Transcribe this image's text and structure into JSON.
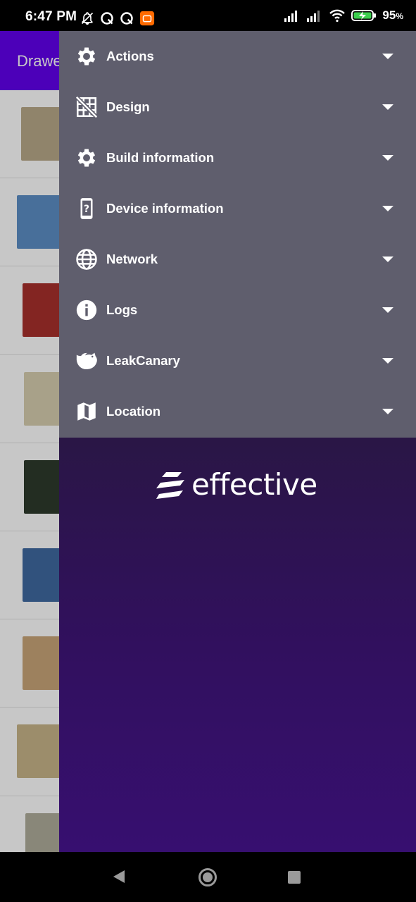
{
  "status_bar": {
    "time": "6:47 PM",
    "battery": "95",
    "battery_unit": "%",
    "icons": [
      "bell-off-icon",
      "q-app-icon",
      "q-app-icon",
      "mi-app-icon",
      "signal-icon",
      "signal-icon",
      "wifi-icon",
      "battery-charging-icon"
    ]
  },
  "app": {
    "title": "Drawer",
    "items": [
      {
        "cover": "zelda-link-to-the-past-cover",
        "color": "#b9a98a"
      },
      {
        "cover": "zelda-phantom-hourglass-cover",
        "color": "#5d8fc6"
      },
      {
        "cover": "zelda-oracle-of-seasons-cover",
        "color": "#a8302c"
      },
      {
        "cover": "zelda-minish-cap-cover",
        "color": "#d8cfb0"
      },
      {
        "cover": "zelda-majoras-mask-cover",
        "color": "#2e3a2c"
      },
      {
        "cover": "zelda-oracle-of-ages-cover",
        "color": "#3f6aa0"
      },
      {
        "cover": "zelda-links-awakening-dx-cover",
        "color": "#c9a679"
      },
      {
        "cover": "zelda-a-link-to-the-past-snes-cover",
        "color": "#c8b58a"
      },
      {
        "cover": "zelda-nes-cover",
        "color": "#b0ad9c"
      }
    ]
  },
  "drawer": {
    "menu": [
      {
        "label": "Actions",
        "icon": "gear-icon"
      },
      {
        "label": "Design",
        "icon": "grid-off-icon"
      },
      {
        "label": "Build information",
        "icon": "gear-icon"
      },
      {
        "label": "Device information",
        "icon": "device-unknown-icon"
      },
      {
        "label": "Network",
        "icon": "globe-icon"
      },
      {
        "label": "Logs",
        "icon": "info-icon"
      },
      {
        "label": "LeakCanary",
        "icon": "leakcanary-bird-icon"
      },
      {
        "label": "Location",
        "icon": "map-icon"
      }
    ],
    "brand": "effective",
    "accent": "#6200ee",
    "menu_background": "#5f5e6d"
  },
  "nav_bar": {
    "icons": [
      "back-icon",
      "home-icon",
      "recents-icon"
    ]
  }
}
